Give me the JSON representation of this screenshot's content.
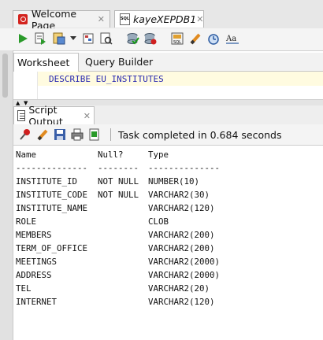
{
  "tabs": [
    {
      "label": "Welcome Page",
      "icon": "oracle-icon"
    },
    {
      "label": "kayeXEPDB1",
      "icon": "sql-worksheet-icon"
    }
  ],
  "toolbar": {
    "icons": [
      "run-statement-icon",
      "run-script-icon",
      "autotrace-icon",
      "dropdown-arrow-icon",
      "explain-plan-icon",
      "sql-tuning-advisor-icon",
      "commit-icon",
      "rollback-icon",
      "unshared-sql-worksheet-icon",
      "clear-icon",
      "history-icon",
      "format-icon"
    ]
  },
  "worksheet": {
    "tabs": [
      "Worksheet",
      "Query Builder"
    ],
    "sql": "DESCRIBE EU_INSTITUTES"
  },
  "script_output": {
    "tab_label": "Script Output",
    "status": "Task completed in 0.684 seconds",
    "toolbar_icons": [
      "pin-icon",
      "clear-output-icon",
      "save-icon",
      "print-icon",
      "export-icon"
    ],
    "header": {
      "name": "Name",
      "null": "Null?",
      "type": "Type"
    },
    "separator": {
      "name": "--------------",
      "null": "--------",
      "type": "--------------"
    },
    "rows": [
      {
        "name": "INSTITUTE_ID",
        "null": "NOT NULL",
        "type": "NUMBER(10)"
      },
      {
        "name": "INSTITUTE_CODE",
        "null": "NOT NULL",
        "type": "VARCHAR2(30)"
      },
      {
        "name": "INSTITUTE_NAME",
        "null": "",
        "type": "VARCHAR2(120)"
      },
      {
        "name": "ROLE",
        "null": "",
        "type": "CLOB"
      },
      {
        "name": "MEMBERS",
        "null": "",
        "type": "VARCHAR2(200)"
      },
      {
        "name": "TERM_OF_OFFICE",
        "null": "",
        "type": "VARCHAR2(200)"
      },
      {
        "name": "MEETINGS",
        "null": "",
        "type": "VARCHAR2(2000)"
      },
      {
        "name": "ADDRESS",
        "null": "",
        "type": "VARCHAR2(2000)"
      },
      {
        "name": "TEL",
        "null": "",
        "type": "VARCHAR2(20)"
      },
      {
        "name": "INTERNET",
        "null": "",
        "type": "VARCHAR2(120)"
      }
    ]
  }
}
